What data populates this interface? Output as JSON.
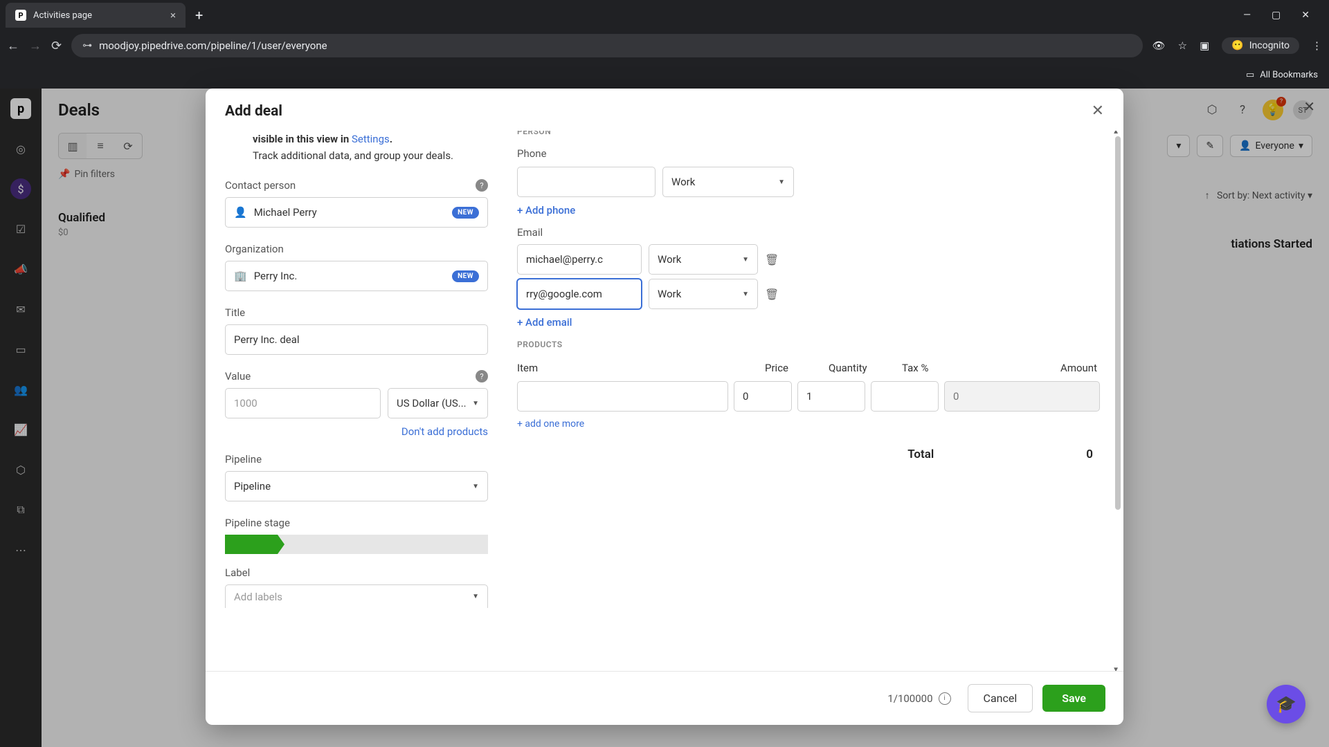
{
  "browser": {
    "tab_title": "Activities page",
    "url": "moodjoy.pipedrive.com/pipeline/1/user/everyone",
    "incognito": "Incognito",
    "all_bookmarks": "All Bookmarks"
  },
  "app": {
    "deals_title": "Deals",
    "avatar_initials": "ST",
    "pin_filters": "Pin filters",
    "everyone": "Everyone",
    "sort_label": "Sort by: Next activity",
    "column_title": "Qualified",
    "column_amount": "$0",
    "negotiations": "tiations Started"
  },
  "modal": {
    "title": "Add deal",
    "info_line1_prefix": "visible in this view in ",
    "info_line1_link": "Settings",
    "info_line1_suffix": ".",
    "info_line2": "Track additional data, and group your deals.",
    "labels": {
      "contact_person": "Contact person",
      "organization": "Organization",
      "title": "Title",
      "value": "Value",
      "pipeline": "Pipeline",
      "pipeline_stage": "Pipeline stage",
      "label": "Label",
      "person": "PERSON",
      "phone": "Phone",
      "email": "Email",
      "products": "PRODUCTS",
      "item": "Item",
      "price": "Price",
      "quantity": "Quantity",
      "tax": "Tax %",
      "amount": "Amount",
      "total": "Total"
    },
    "values": {
      "contact_person": "Michael Perry",
      "organization": "Perry Inc.",
      "title": "Perry Inc. deal",
      "value": "1000",
      "currency": "US Dollar (US...",
      "pipeline_value": "Pipeline",
      "label_placeholder": "Add labels",
      "phone_type": "Work",
      "email1": "michael@perry.c",
      "email1_type": "Work",
      "email2": "rry@google.com",
      "email2_type": "Work",
      "price": "0",
      "quantity": "1",
      "amount_placeholder": "0",
      "total_value": "0"
    },
    "badges": {
      "new": "NEW"
    },
    "links": {
      "dont_add_products": "Don't add products",
      "add_phone": "+ Add phone",
      "add_email": "+ Add email",
      "add_one_more": "+ add one more"
    },
    "footer": {
      "count": "1/100000",
      "cancel": "Cancel",
      "save": "Save"
    }
  }
}
